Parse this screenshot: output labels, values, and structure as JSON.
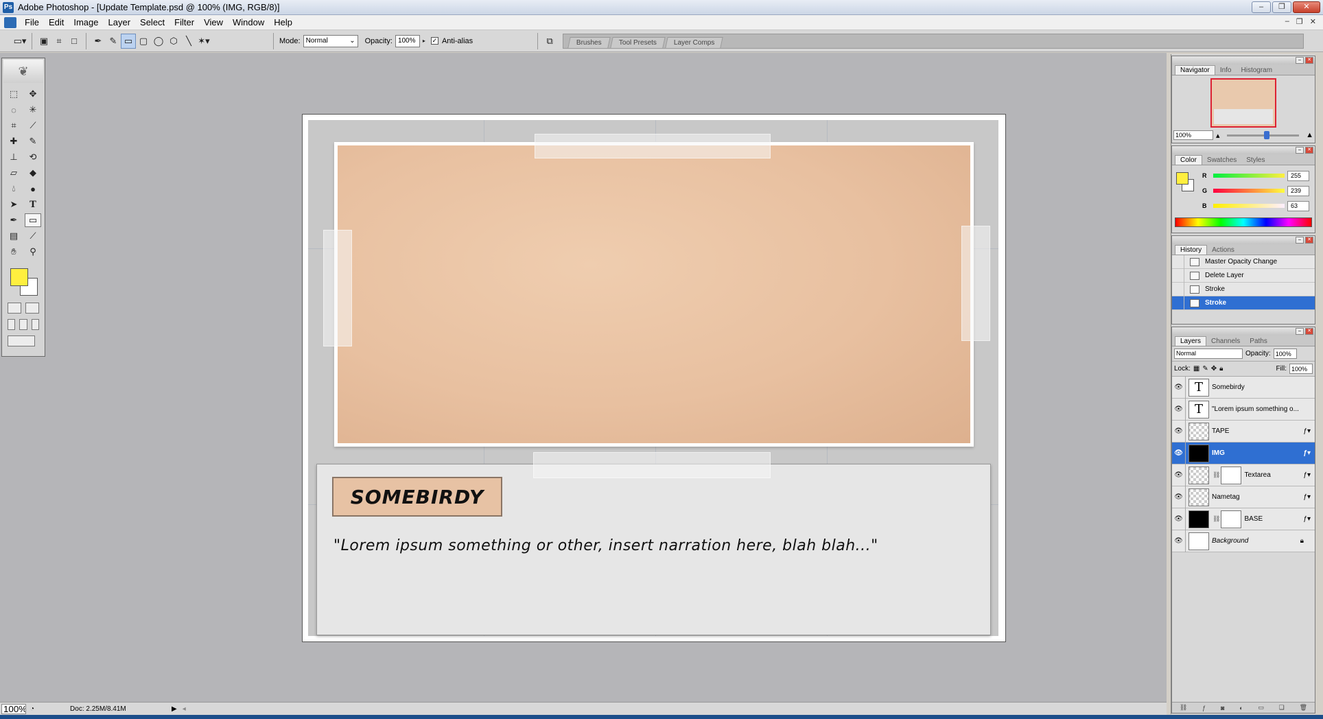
{
  "window": {
    "title": "Adobe Photoshop - [Update Template.psd @ 100% (IMG, RGB/8)]",
    "buttons": {
      "minimize": "–",
      "restore": "❐",
      "close": "✕"
    }
  },
  "menu": {
    "items": [
      "File",
      "Edit",
      "Image",
      "Layer",
      "Select",
      "Filter",
      "View",
      "Window",
      "Help"
    ],
    "doc_buttons": {
      "minimize": "–",
      "restore": "❐",
      "close": "✕"
    }
  },
  "options": {
    "mode_label": "Mode:",
    "mode_value": "Normal",
    "opacity_label": "Opacity:",
    "opacity_value": "100%",
    "antialias_label": "Anti-alias",
    "antialias_checked": true,
    "well_tabs": [
      "Brushes",
      "Tool Presets",
      "Layer Comps"
    ]
  },
  "canvas": {
    "nametag": "SOMEBIRDY",
    "narration": "\"Lorem ipsum something or other, insert narration here, blah blah...\""
  },
  "status": {
    "zoom": "100%",
    "doc": "Doc: 2.25M/8.41M"
  },
  "navigator": {
    "tabs": [
      "Navigator",
      "Info",
      "Histogram"
    ],
    "zoom": "100%"
  },
  "color": {
    "tabs": [
      "Color",
      "Swatches",
      "Styles"
    ],
    "foreground": "#ffef3f",
    "channels": [
      {
        "label": "R",
        "value": "255"
      },
      {
        "label": "G",
        "value": "239"
      },
      {
        "label": "B",
        "value": "63"
      }
    ]
  },
  "history": {
    "tabs": [
      "History",
      "Actions"
    ],
    "items": [
      "Master Opacity Change",
      "Delete Layer",
      "Stroke",
      "Stroke"
    ]
  },
  "layers": {
    "tabs": [
      "Layers",
      "Channels",
      "Paths"
    ],
    "blend_mode": "Normal",
    "opacity_label": "Opacity:",
    "opacity_value": "100%",
    "lock_label": "Lock:",
    "fill_label": "Fill:",
    "fill_value": "100%",
    "items": [
      {
        "name": "Somebirdy"
      },
      {
        "name": "\"Lorem ipsum something o..."
      },
      {
        "name": "TAPE"
      },
      {
        "name": "IMG"
      },
      {
        "name": "Textarea"
      },
      {
        "name": "Nametag"
      },
      {
        "name": "BASE"
      },
      {
        "name": "Background"
      }
    ]
  },
  "colors": {
    "selection": "#2f6fd2",
    "workspace": "#b5b5b8",
    "photo": "#e8c0a0"
  }
}
